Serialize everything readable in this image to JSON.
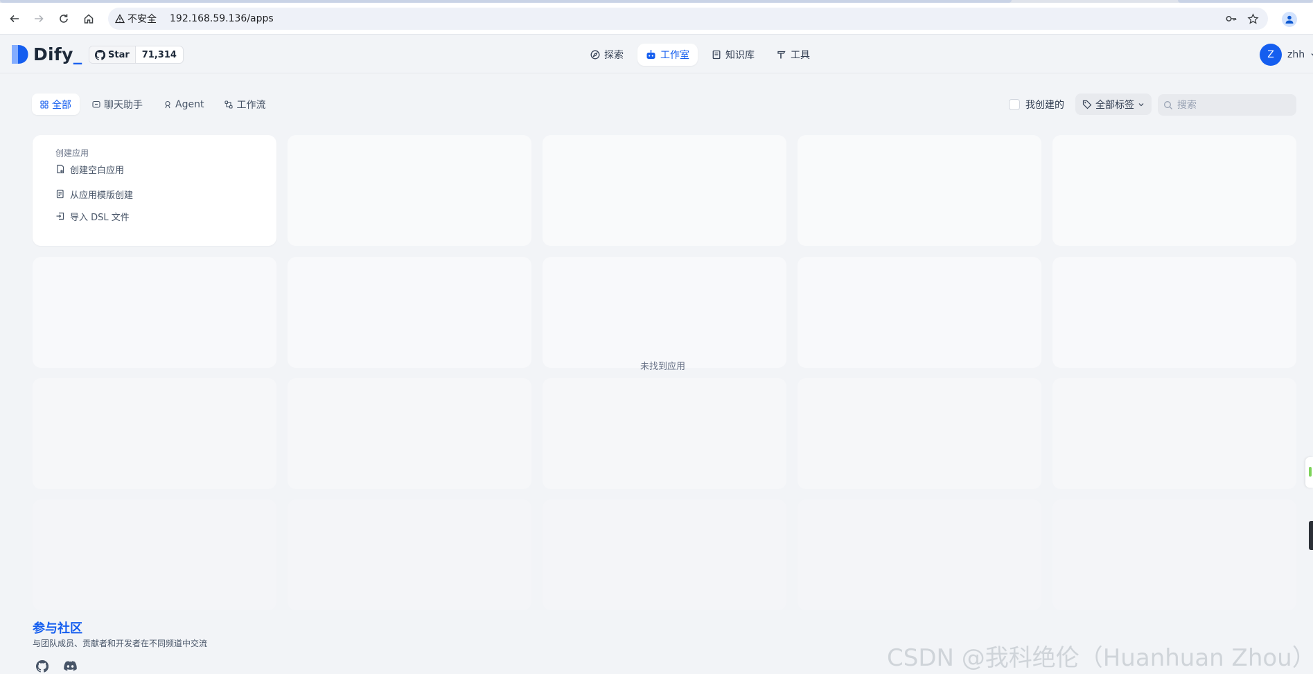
{
  "browser": {
    "security_label": "不安全",
    "url": "192.168.59.136/apps"
  },
  "brand": {
    "name": "Dify",
    "accent": "#155eef"
  },
  "github": {
    "star_label": "Star",
    "count": "71,314"
  },
  "nav": {
    "items": [
      {
        "label": "探索",
        "icon": "compass-icon",
        "active": false
      },
      {
        "label": "工作室",
        "icon": "robot-icon",
        "active": true
      },
      {
        "label": "知识库",
        "icon": "book-icon",
        "active": false
      },
      {
        "label": "工具",
        "icon": "hammer-icon",
        "active": false
      }
    ]
  },
  "user": {
    "initial": "Z",
    "name": "zhh"
  },
  "filters": {
    "tabs": [
      {
        "label": "全部",
        "icon": "grid-icon",
        "active": true
      },
      {
        "label": "聊天助手",
        "icon": "chat-icon",
        "active": false
      },
      {
        "label": "Agent",
        "icon": "agent-icon",
        "active": false
      },
      {
        "label": "工作流",
        "icon": "workflow-icon",
        "active": false
      }
    ],
    "mine_label": "我创建的",
    "tag_label": "全部标签",
    "search_placeholder": "搜索"
  },
  "create": {
    "title": "创建应用",
    "items": [
      {
        "label": "创建空白应用",
        "icon": "file-plus-icon"
      },
      {
        "label": "从应用模版创建",
        "icon": "template-icon"
      },
      {
        "label": "导入 DSL 文件",
        "icon": "import-icon"
      }
    ]
  },
  "empty_text": "未找到应用",
  "community": {
    "title": "参与社区",
    "desc": "与团队成员、贡献者和开发者在不同频道中交流"
  },
  "watermark": "CSDN @我科绝伦（Huanhuan Zhou）"
}
